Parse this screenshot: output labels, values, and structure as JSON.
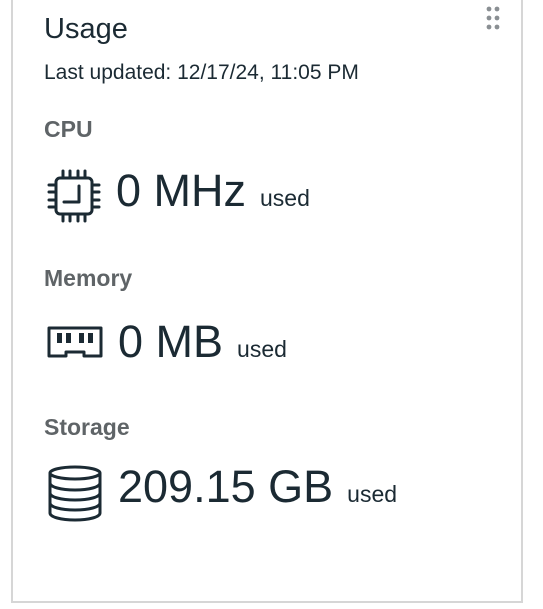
{
  "card": {
    "title": "Usage",
    "last_updated": "Last updated: 12/17/24, 11:05 PM",
    "metrics": [
      {
        "label": "CPU",
        "value": "0 MHz",
        "unit": "used",
        "icon": "cpu-icon"
      },
      {
        "label": "Memory",
        "value": "0 MB",
        "unit": "used",
        "icon": "memory-icon"
      },
      {
        "label": "Storage",
        "value": "209.15 GB",
        "unit": "used",
        "icon": "storage-icon"
      }
    ],
    "drag_handle_icon": "drag-handle-icon"
  },
  "colors": {
    "text": "#1b2a33",
    "label": "#5f6467",
    "border": "#d6d6d6",
    "grip": "#8a8f93"
  }
}
